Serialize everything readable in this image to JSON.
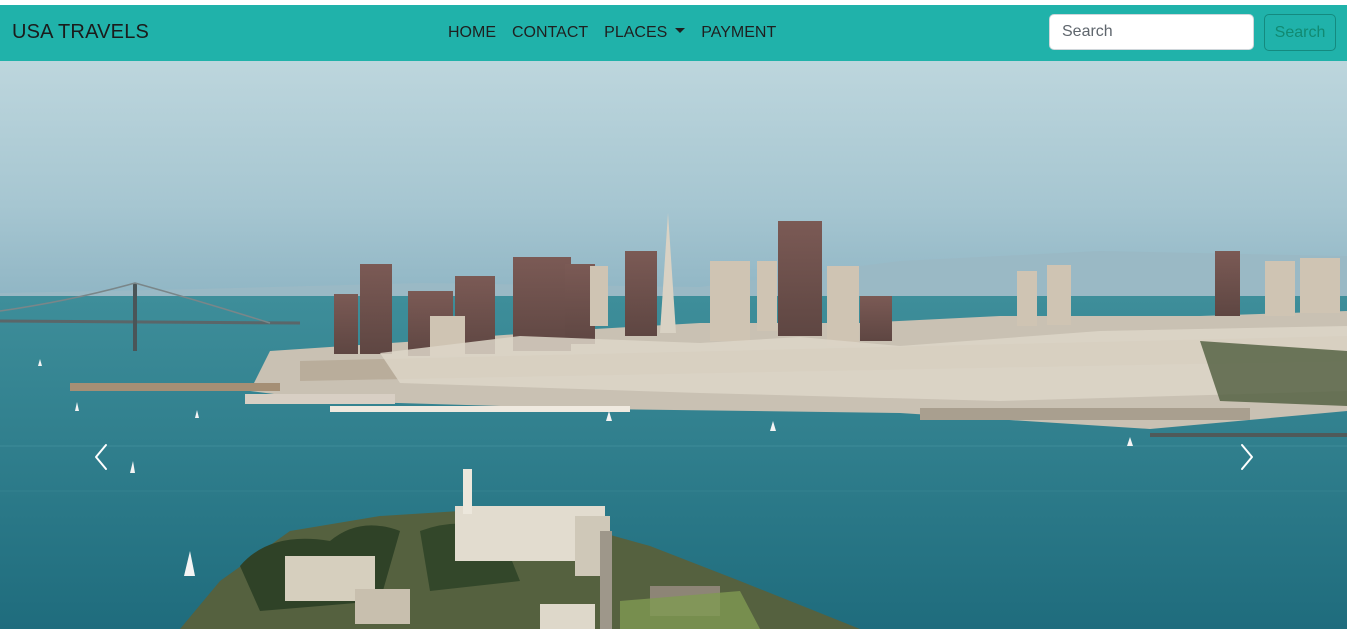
{
  "navbar": {
    "brand": "USA TRAVELS",
    "links": [
      {
        "label": "HOME"
      },
      {
        "label": "CONTACT"
      },
      {
        "label": "PLACES",
        "has_dropdown": true
      },
      {
        "label": "PAYMENT"
      }
    ],
    "search": {
      "placeholder": "Search",
      "value": "",
      "button_label": "Search"
    }
  },
  "carousel": {
    "image_subject": "San Francisco skyline and bay with Alcatraz island in foreground",
    "prev_icon": "chevron-left-icon",
    "next_icon": "chevron-right-icon"
  },
  "colors": {
    "navbar_bg": "#20b2aa",
    "search_button_border": "#148a7f",
    "search_button_text": "#118a72",
    "sky": "#a9c8d3",
    "water": "#2b7f8c"
  }
}
